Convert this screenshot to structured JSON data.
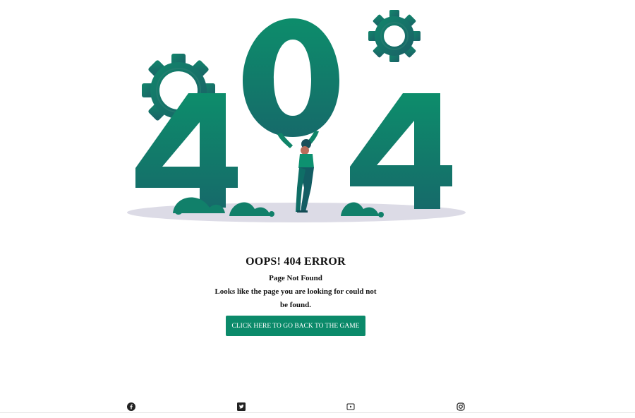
{
  "error": {
    "title": "OOPS! 404 ERROR",
    "subtitle": "Page Not Found",
    "description": "Looks like the page you are looking for could not be found.",
    "button_label": "CLICK HERE TO GO BACK TO THE GAME"
  },
  "footer": {
    "social": [
      {
        "icon": "facebook-icon"
      },
      {
        "icon": "twitter-icon"
      },
      {
        "icon": "youtube-icon"
      },
      {
        "icon": "instagram-icon"
      }
    ]
  },
  "colors": {
    "accent": "#0b8a6a",
    "illustration_light": "#0d8d6b",
    "illustration_dark": "#166a6a",
    "ground": "#dcdbe6"
  }
}
